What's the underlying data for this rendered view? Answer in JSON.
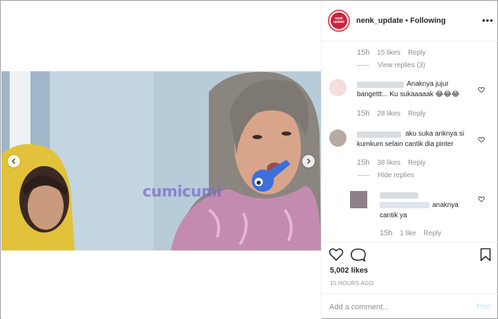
{
  "header": {
    "username": "nenk_update",
    "separator": "•",
    "follow_status": "Following",
    "more": "•••",
    "avatar_text": "nenk update"
  },
  "media": {
    "watermark": "cumicumi"
  },
  "comments": [
    {
      "time": "15h",
      "likes": "15 likes",
      "reply": "Reply",
      "view_replies": "View replies (3)"
    },
    {
      "text_line1": "Anaknya jujur",
      "text_line2": "bangettt... Ku sukaaaaak 😂😂😂",
      "time": "15h",
      "likes": "28 likes",
      "reply": "Reply"
    },
    {
      "text_line1": "aku suka anknya si",
      "text_line2": "kumkum selain cantik dia pinter",
      "time": "15h",
      "likes": "38 likes",
      "reply": "Reply",
      "hide_replies": "Hide replies"
    },
    {
      "text_line1": "anaknya",
      "text_line2": "cantik ya",
      "time": "15h",
      "likes": "1 like",
      "reply": "Reply"
    }
  ],
  "post": {
    "likes": "5,002 likes",
    "time_ago": "15 HOURS AGO"
  },
  "add_comment": {
    "placeholder": "Add a comment...",
    "post_label": "Post"
  },
  "colors": {
    "link_blue_disabled": "#b2dffc",
    "meta_gray": "#8e8e8e",
    "story_ring": "#e9475c"
  }
}
